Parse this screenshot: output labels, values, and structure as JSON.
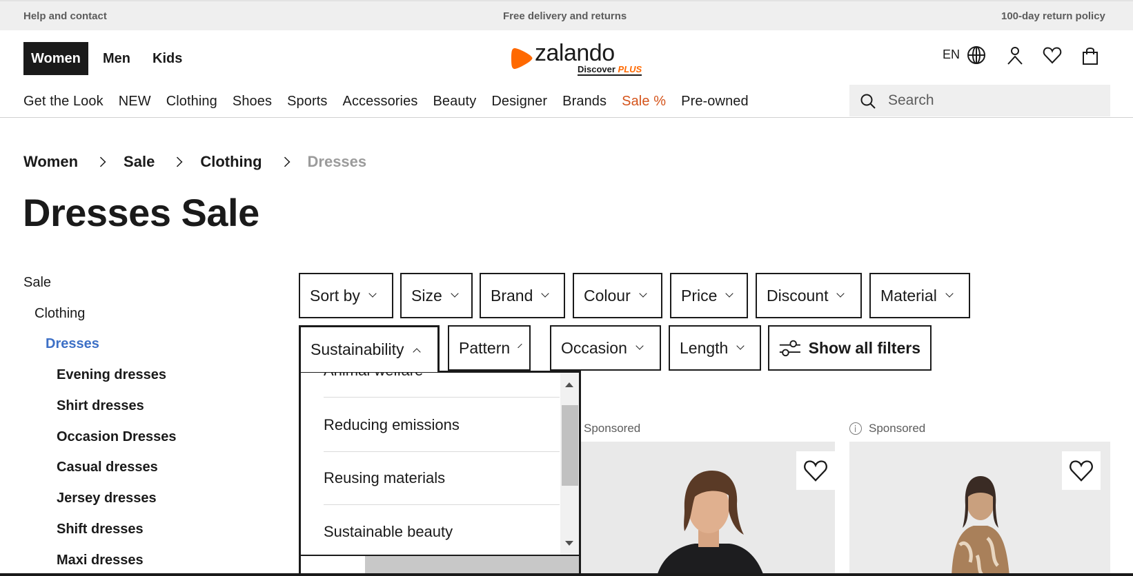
{
  "topbar": {
    "left": "Help and contact",
    "center": "Free delivery and returns",
    "right": "100-day return policy"
  },
  "gender_nav": [
    {
      "label": "Women",
      "active": true
    },
    {
      "label": "Men",
      "active": false
    },
    {
      "label": "Kids",
      "active": false
    }
  ],
  "logo": {
    "wordmark": "zalando",
    "sub": "Discover",
    "sub_accent": "PLUS",
    "brand_color": "#ff6900"
  },
  "header_actions": {
    "language": "EN",
    "icons": [
      "globe-icon",
      "user-icon",
      "wishlist-heart-icon",
      "shopping-bag-icon"
    ]
  },
  "category_nav": [
    {
      "label": "Get the Look"
    },
    {
      "label": "NEW"
    },
    {
      "label": "Clothing"
    },
    {
      "label": "Shoes"
    },
    {
      "label": "Sports"
    },
    {
      "label": "Accessories"
    },
    {
      "label": "Beauty"
    },
    {
      "label": "Designer"
    },
    {
      "label": "Brands"
    },
    {
      "label": "Sale %",
      "highlight": true,
      "color": "#d4531a"
    },
    {
      "label": "Pre-owned"
    }
  ],
  "search": {
    "placeholder": "Search",
    "value": ""
  },
  "breadcrumb": [
    {
      "label": "Women"
    },
    {
      "label": "Sale"
    },
    {
      "label": "Clothing"
    },
    {
      "label": "Dresses",
      "current": true
    }
  ],
  "page_title": "Dresses Sale",
  "sidebar": {
    "items": [
      {
        "label": "Sale",
        "level": 0
      },
      {
        "label": "Clothing",
        "level": 1
      },
      {
        "label": "Dresses",
        "level": 2,
        "active": true,
        "color": "#3d70c6"
      },
      {
        "label": "Evening dresses",
        "level": 3
      },
      {
        "label": "Shirt dresses",
        "level": 3
      },
      {
        "label": "Occasion Dresses",
        "level": 3
      },
      {
        "label": "Casual dresses",
        "level": 3
      },
      {
        "label": "Jersey dresses",
        "level": 3
      },
      {
        "label": "Shift dresses",
        "level": 3
      },
      {
        "label": "Maxi dresses",
        "level": 3
      }
    ]
  },
  "filters": {
    "row1": [
      {
        "label": "Sort by"
      },
      {
        "label": "Size"
      },
      {
        "label": "Brand"
      },
      {
        "label": "Colour"
      },
      {
        "label": "Price"
      },
      {
        "label": "Discount"
      },
      {
        "label": "Material"
      }
    ],
    "row2": [
      {
        "label": "Sustainability",
        "open": true
      },
      {
        "label": "Pattern"
      },
      {
        "label": "Occasion"
      },
      {
        "label": "Length"
      }
    ],
    "show_all": "Show all filters"
  },
  "sustainability_dropdown": {
    "options": [
      "Animal welfare",
      "Reducing emissions",
      "Reusing materials",
      "Sustainable beauty"
    ],
    "scroll_position": 0.35
  },
  "products": [
    {
      "badge": "Sponsored",
      "wishlisted": false
    },
    {
      "badge": "Sponsored",
      "wishlisted": false
    }
  ]
}
